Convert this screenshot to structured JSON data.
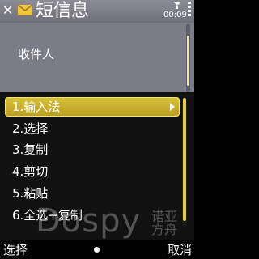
{
  "header": {
    "title": "短信息",
    "time": "00:09"
  },
  "recipient": {
    "label": "收件人"
  },
  "menu": {
    "items": [
      {
        "label": "1.输入法",
        "selected": true
      },
      {
        "label": "2.选择"
      },
      {
        "label": "3.复制"
      },
      {
        "label": "4.剪切"
      },
      {
        "label": "5.粘贴"
      },
      {
        "label": "6.全选+复制"
      }
    ]
  },
  "softkeys": {
    "left": "选择",
    "right": "取消"
  },
  "watermark": {
    "text": "Dospy",
    "text_cn": "诺亚方舟"
  },
  "colors": {
    "highlight": "#d8c23a",
    "envelope": "#f0c640"
  }
}
